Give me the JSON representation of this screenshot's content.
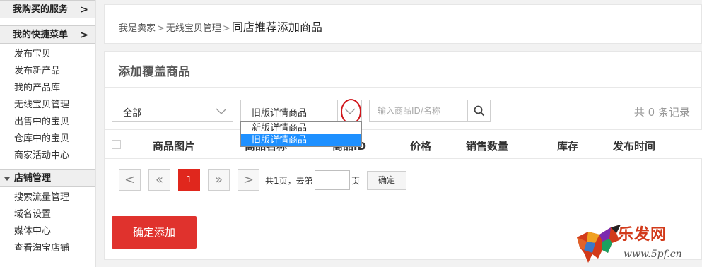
{
  "sidebar": {
    "services_header": "我购买的服务",
    "shortcut_header": "我的快捷菜单",
    "chevron": ">",
    "shortcut_items": [
      "发布宝贝",
      "发布新产品",
      "我的产品库",
      "无线宝贝管理",
      "出售中的宝贝",
      "仓库中的宝贝",
      "商家活动中心"
    ],
    "shop_header": "店铺管理",
    "shop_items": [
      "搜索流量管理",
      "域名设置",
      "媒体中心",
      "查看淘宝店铺"
    ]
  },
  "breadcrumb": {
    "items": [
      "我是卖家",
      "无线宝贝管理"
    ],
    "separator": ">",
    "current": "同店推荐添加商品"
  },
  "main": {
    "title": "添加覆盖商品",
    "filter_category": "全部",
    "filter_type": "旧版详情商品",
    "search_placeholder": "输入商品ID/名称",
    "record_count": "共 0 条记录",
    "dropdown_options": [
      "新版详情商品",
      "旧版详情商品"
    ],
    "columns": [
      "商品图片",
      "商品名称",
      "商品ID",
      "价格",
      "销售数量",
      "库存",
      "发布时间"
    ],
    "pager": {
      "prev": "<",
      "first": "«",
      "current_page": "1",
      "last": "»",
      "next": ">",
      "summary": "共1页，去第",
      "page_suffix": "页",
      "go_label": "确定"
    },
    "confirm_label": "确定添加"
  },
  "watermark": {
    "brand": "乐发网",
    "url": "www.5pf.cn"
  },
  "colors": {
    "accent_red": "#e0322d",
    "selected_blue": "#1e90ff",
    "highlight_circle": "#d0161b"
  }
}
